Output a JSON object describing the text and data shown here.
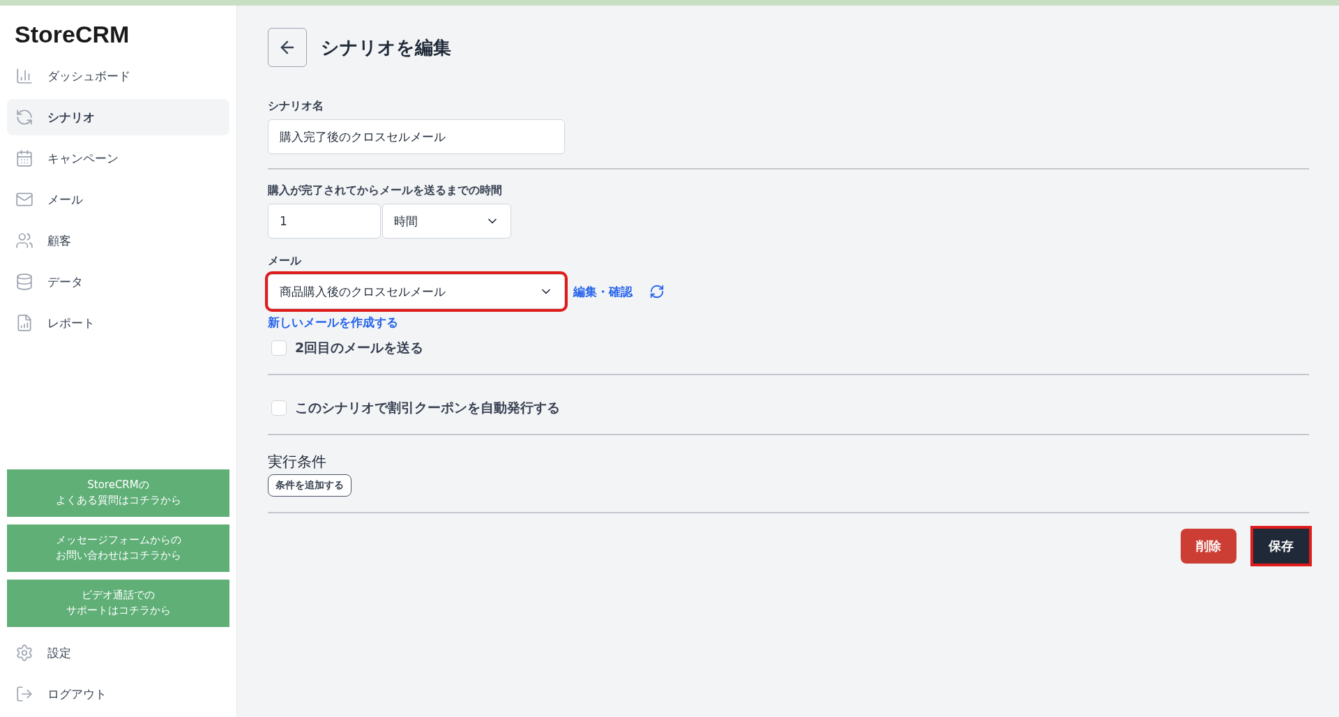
{
  "sidebar": {
    "logo": "StoreCRM",
    "items": [
      {
        "label": "ダッシュボード",
        "kind": "chart",
        "selected": false
      },
      {
        "label": "シナリオ",
        "kind": "cycle",
        "selected": true
      },
      {
        "label": "キャンペーン",
        "kind": "calendar",
        "selected": false
      },
      {
        "label": "メール",
        "kind": "mail",
        "selected": false
      },
      {
        "label": "顧客",
        "kind": "users",
        "selected": false
      },
      {
        "label": "データ",
        "kind": "database",
        "selected": false
      },
      {
        "label": "レポート",
        "kind": "report",
        "selected": false
      }
    ],
    "help_buttons": [
      {
        "lines": [
          "StoreCRMの",
          "よくある質問はコチラから"
        ]
      },
      {
        "lines": [
          "メッセージフォームからの",
          "お問い合わせはコチラから"
        ]
      },
      {
        "lines": [
          "ビデオ通話での",
          "サポートはコチラから"
        ]
      }
    ],
    "bottom_items": [
      {
        "label": "設定",
        "kind": "gear"
      },
      {
        "label": "ログアウト",
        "kind": "logout"
      }
    ]
  },
  "page": {
    "title": "シナリオを編集",
    "scenario_name": {
      "label": "シナリオ名",
      "value": "購入完了後のクロスセルメール"
    },
    "delay": {
      "label": "購入が完了されてからメールを送るまでの時間",
      "amount": "1",
      "unit": "時間"
    },
    "mail": {
      "label": "メール",
      "value": "商品購入後のクロスセルメール",
      "highlighted": true,
      "edit_link": "編集・確認",
      "new_link": "新しいメールを作成する"
    },
    "second_mail": {
      "label": "2回目のメールを送る",
      "checked": false
    },
    "coupon": {
      "label": "このシナリオで割引クーポンを自動発行する",
      "checked": false
    },
    "conditions": {
      "title": "実行条件",
      "add_button": "条件を追加する"
    },
    "actions": [
      {
        "label": "削除",
        "kind": "danger",
        "highlighted": false
      },
      {
        "label": "保存",
        "kind": "primary",
        "highlighted": true
      }
    ]
  }
}
